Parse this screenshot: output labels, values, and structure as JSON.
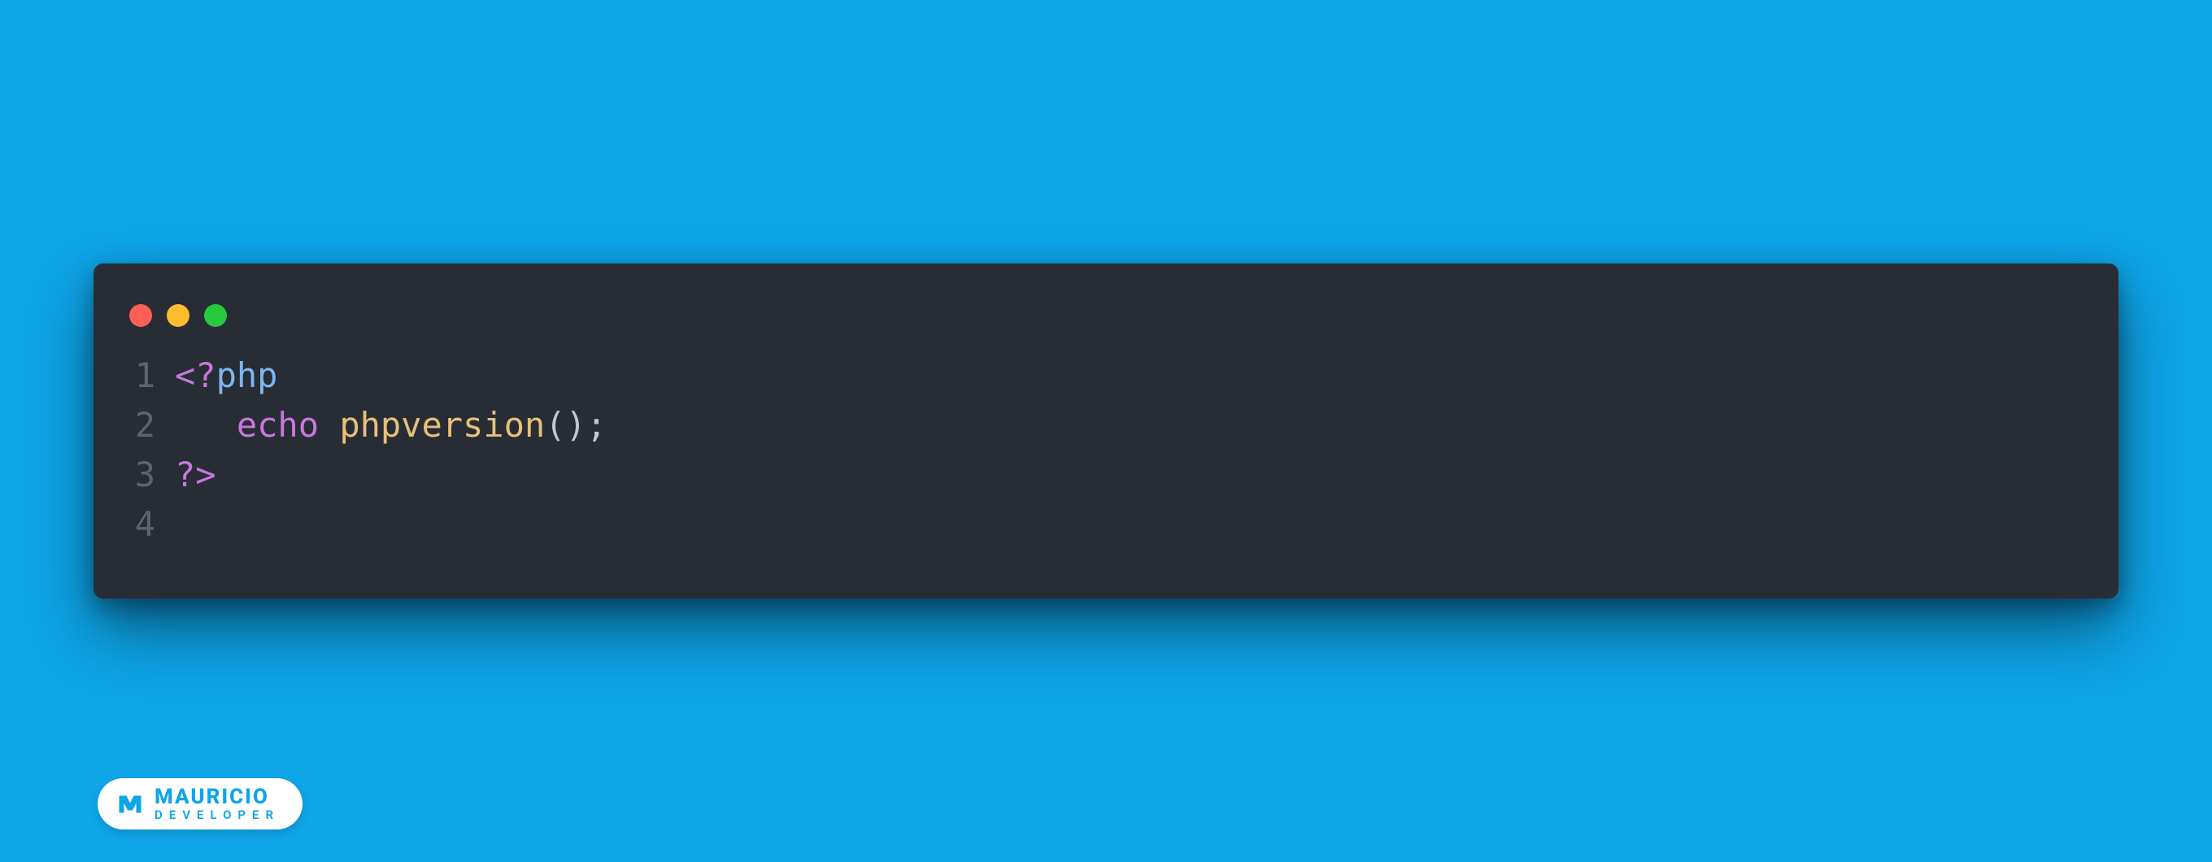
{
  "window": {
    "dots": [
      "close",
      "minimize",
      "zoom"
    ]
  },
  "code": {
    "language": "php",
    "lines": [
      {
        "n": "1",
        "tokens": [
          {
            "t": "<?",
            "c": "tok-tag"
          },
          {
            "t": "php",
            "c": "tok-kw"
          }
        ]
      },
      {
        "n": "2",
        "tokens": [
          {
            "t": "   ",
            "c": ""
          },
          {
            "t": "echo",
            "c": "tok-echo"
          },
          {
            "t": " ",
            "c": ""
          },
          {
            "t": "phpversion",
            "c": "tok-fn"
          },
          {
            "t": "();",
            "c": "tok-punct"
          }
        ]
      },
      {
        "n": "3",
        "tokens": [
          {
            "t": "?>",
            "c": "tok-tag"
          }
        ]
      },
      {
        "n": "4",
        "tokens": []
      }
    ]
  },
  "badge": {
    "name": "MAURICIO",
    "subtitle": "DEVELOPER"
  }
}
